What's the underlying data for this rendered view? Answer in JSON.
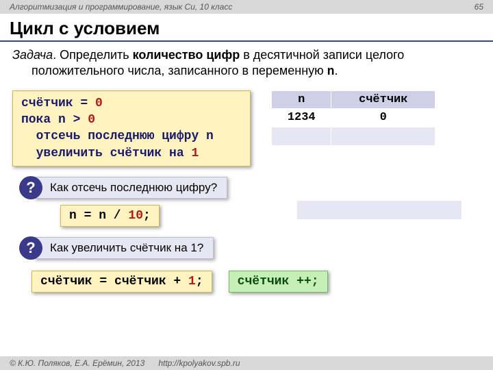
{
  "header": {
    "course": "Алгоритмизация и программирование, язык Си, 10 класс",
    "page": "65"
  },
  "title": "Цикл с условием",
  "task": {
    "label": "Задача",
    "t1": ". Определить ",
    "bold": "количество цифр",
    "t2": " в десятичной записи целого положительного числа, записанного в переменную ",
    "var": "n",
    "t3": "."
  },
  "pseudocode": {
    "l1a": "счётчик = ",
    "l1b": "0",
    "l2a": "пока n > ",
    "l2b": "0",
    "l3": "  отсечь последнюю цифру n",
    "l4a": "  увеличить счётчик на ",
    "l4b": "1"
  },
  "table": {
    "h1": "n",
    "h2": "счётчик",
    "r1c1": "1234",
    "r1c2": "0",
    "r2c1": "",
    "r2c2": "",
    "r3c1": "",
    "r3c2": ""
  },
  "q1": {
    "mark": "?",
    "text": " Как отсечь последнюю цифру?"
  },
  "ans1": {
    "a": "n = n / ",
    "num": "10",
    "semi": ";"
  },
  "q2": {
    "mark": "?",
    "text": " Как увеличить счётчик на 1?"
  },
  "ans2a": {
    "a": "счётчик = счётчик + ",
    "num": "1",
    "semi": ";"
  },
  "ans2b": {
    "a": "счётчик ++;"
  },
  "footer": {
    "copyright": "© К.Ю. Поляков, Е.А. Ерёмин, 2013",
    "url": "http://kpolyakov.spb.ru"
  }
}
